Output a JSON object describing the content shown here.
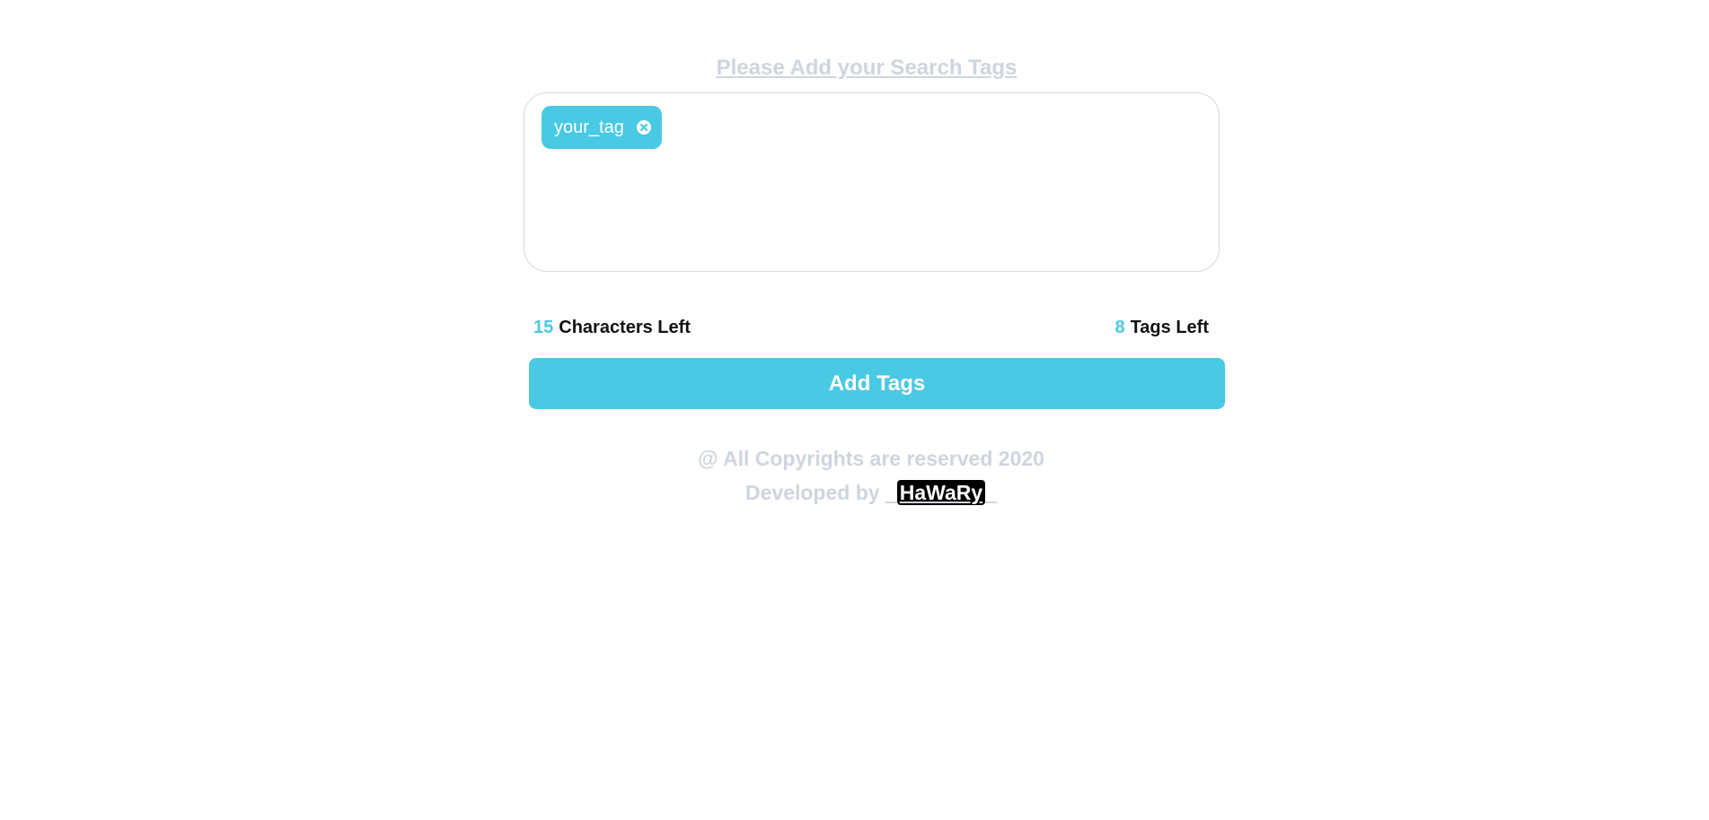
{
  "header": {
    "title": "Please Add your Search Tags"
  },
  "tags": [
    {
      "label": "your_tag",
      "remove_icon": "close-circle-icon"
    }
  ],
  "counters": {
    "characters_value": "15",
    "characters_label": "Characters Left",
    "tags_value": "8",
    "tags_label": "Tags Left"
  },
  "actions": {
    "add_label": "Add Tags"
  },
  "footer": {
    "copyright": "@ All Copyrights are reserved 2020",
    "developed_by": "Developed by",
    "underscore_left": "_",
    "developer": "HaWaRy",
    "underscore_right": "_"
  },
  "colors": {
    "accent": "#49c9e3",
    "muted_text": "#cfd5de",
    "border": "#d8d8de"
  }
}
